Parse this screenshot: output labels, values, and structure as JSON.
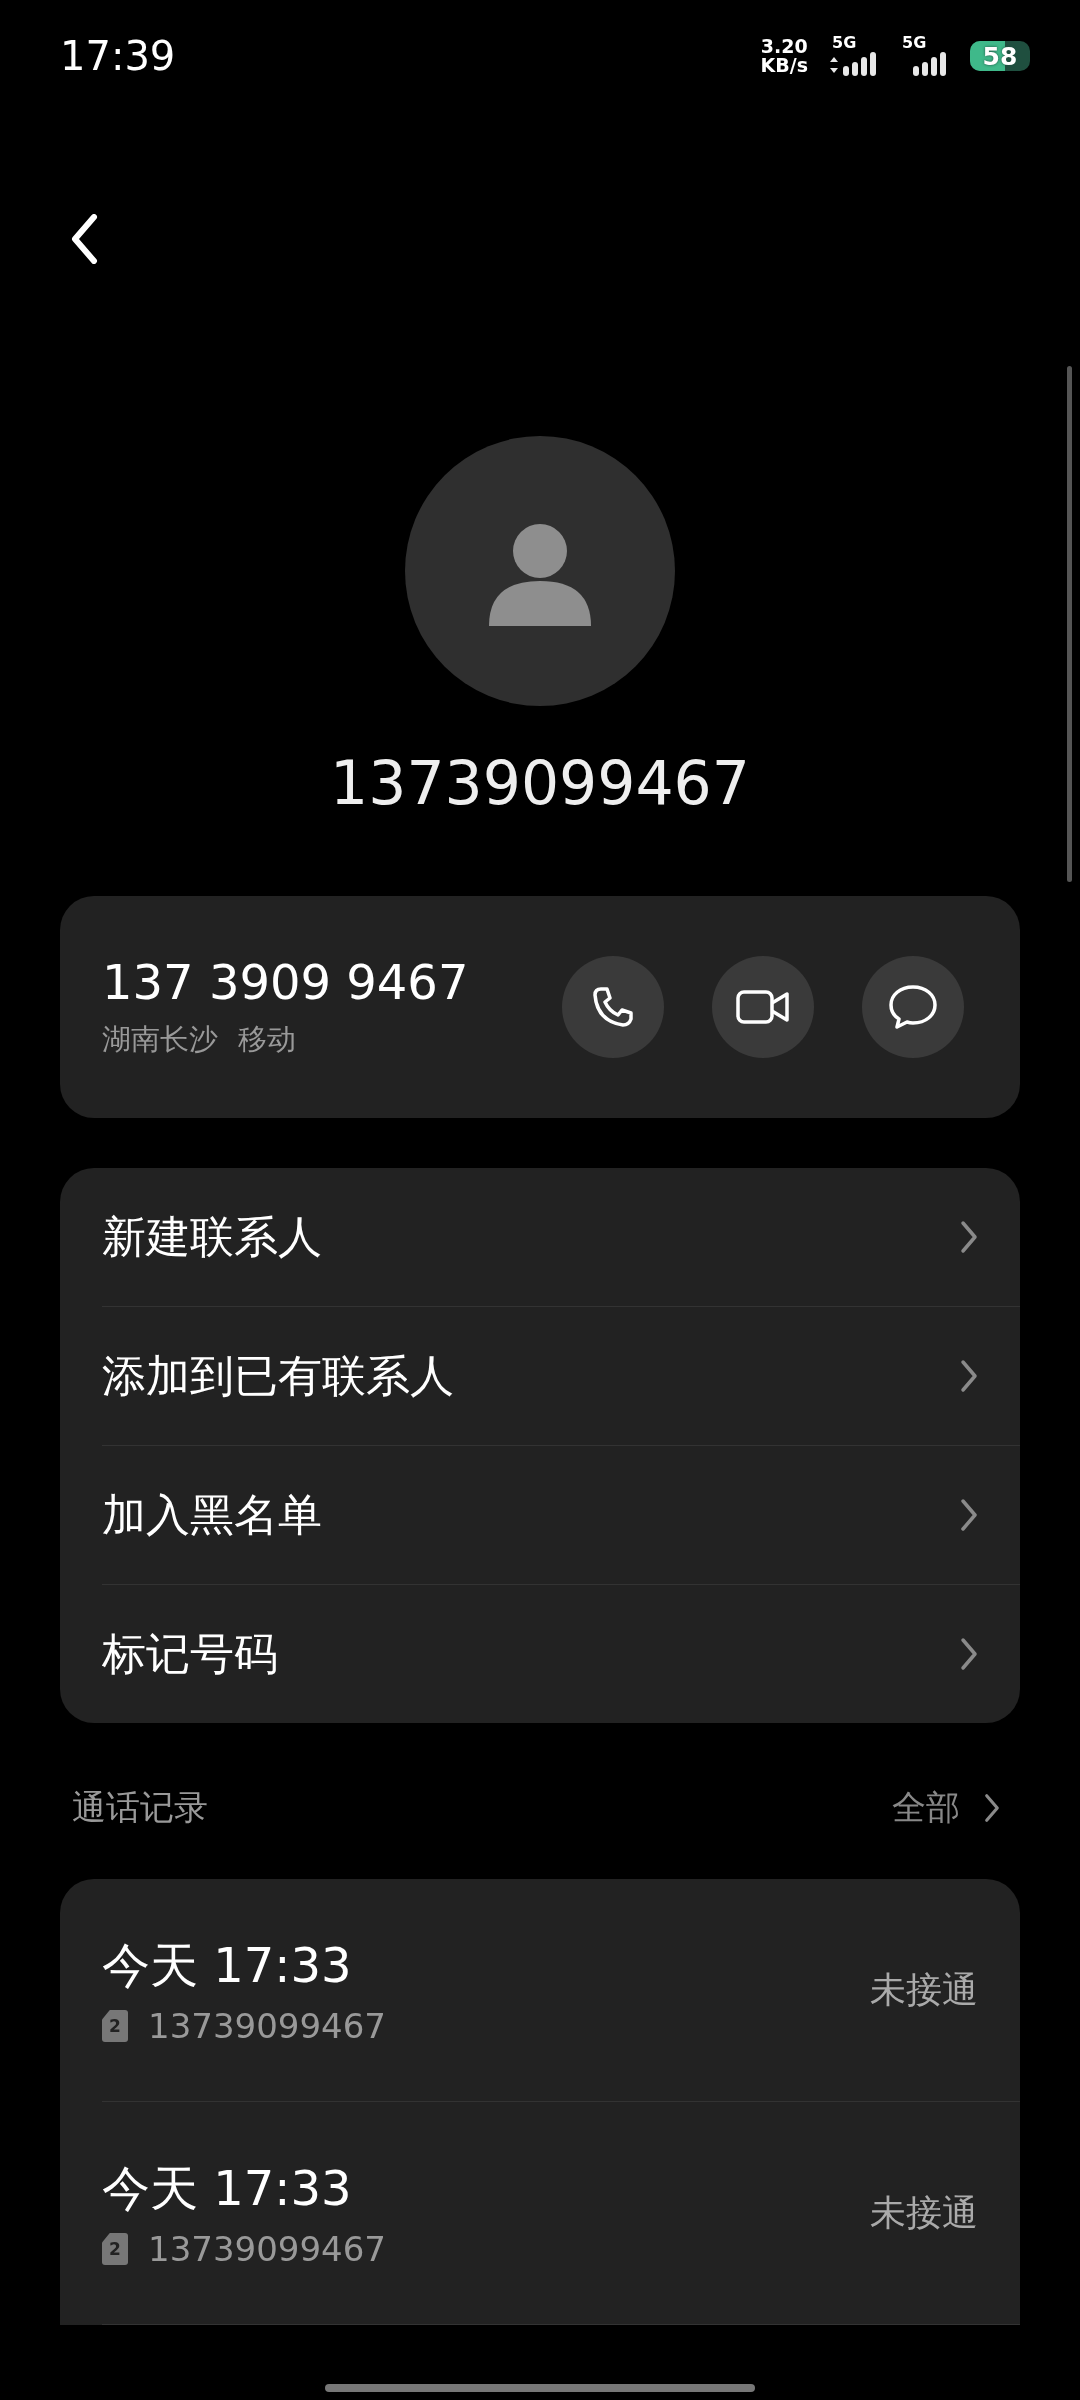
{
  "status_bar": {
    "time": "17:39",
    "speed_value": "3.20",
    "speed_unit": "KB/s",
    "networks": [
      {
        "label": "5G",
        "data_arrows": true
      },
      {
        "label": "5G",
        "data_arrows": false
      }
    ],
    "battery": {
      "text": "58",
      "level": 0.58
    }
  },
  "contact": {
    "title": "13739099467",
    "number": "137 3909 9467",
    "location": "湖南长沙",
    "carrier": "移动"
  },
  "actions": [
    {
      "kind": "call"
    },
    {
      "kind": "video"
    },
    {
      "kind": "message"
    }
  ],
  "menu": [
    {
      "label": "新建联系人"
    },
    {
      "label": "添加到已有联系人"
    },
    {
      "label": "加入黑名单"
    },
    {
      "label": "标记号码"
    }
  ],
  "call_log": {
    "title": "通话记录",
    "all_link": "全部",
    "rows": [
      {
        "time": "今天 17:33",
        "sim": "2",
        "number": "13739099467",
        "status": "未接通"
      },
      {
        "time": "今天 17:33",
        "sim": "2",
        "number": "13739099467",
        "status": "未接通"
      }
    ]
  }
}
